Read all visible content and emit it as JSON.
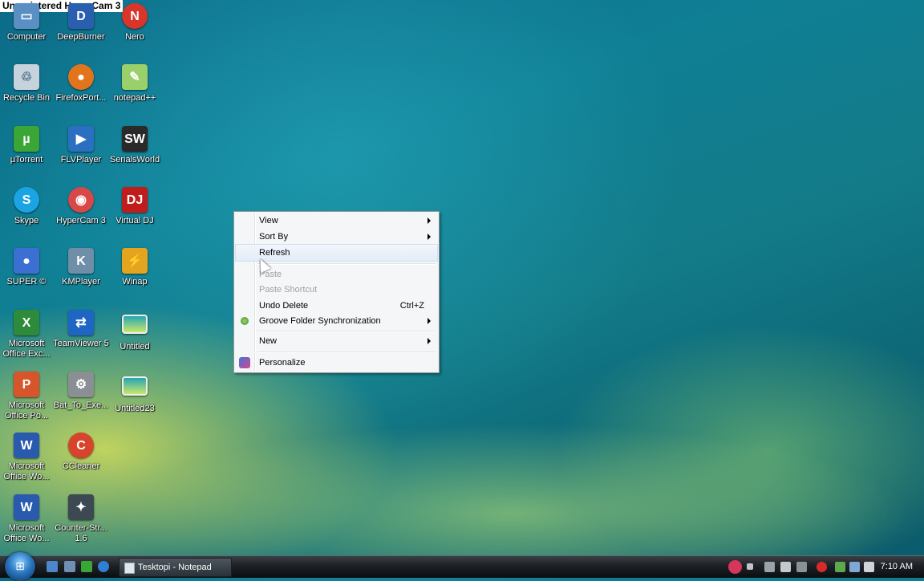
{
  "banner": {
    "text": "Unregistered HyperCam 3"
  },
  "desktop_icons": [
    {
      "label": "Computer",
      "icon": "computer-icon",
      "color": "#5a8fc4"
    },
    {
      "label": "DeepBurner",
      "icon": "deepburner-icon",
      "color": "#2a5fb0"
    },
    {
      "label": "Nero",
      "icon": "nero-icon",
      "color": "#d8352b"
    },
    {
      "label": "Recycle Bin",
      "icon": "recycle-bin-icon",
      "color": "#c6d3dd"
    },
    {
      "label": "FirefoxPort...",
      "icon": "firefox-icon",
      "color": "#e2741b"
    },
    {
      "label": "notepad++",
      "icon": "notepad-plus-plus-icon",
      "color": "#9ad06a"
    },
    {
      "label": "µTorrent",
      "icon": "utorrent-icon",
      "color": "#3aa635"
    },
    {
      "label": "FLVPlayer",
      "icon": "flvplayer-icon",
      "color": "#2b6fc1"
    },
    {
      "label": "SerialsWorld",
      "icon": "serialsworld-icon",
      "color": "#2a2a2a"
    },
    {
      "label": "Skype",
      "icon": "skype-icon",
      "color": "#1ba4e3"
    },
    {
      "label": "HyperCam 3",
      "icon": "hypercam-icon",
      "color": "#d94848"
    },
    {
      "label": "Virtual DJ",
      "icon": "virtual-dj-icon",
      "color": "#c11c1c"
    },
    {
      "label": "SUPER ©",
      "icon": "super-icon",
      "color": "#3b6fd1"
    },
    {
      "label": "KMPlayer",
      "icon": "kmplayer-icon",
      "color": "#6f8ea8"
    },
    {
      "label": "Winap",
      "icon": "winamp-icon",
      "color": "#e3a520"
    },
    {
      "label": "Microsoft Office Exc...",
      "icon": "excel-icon",
      "color": "#2e8b3c"
    },
    {
      "label": "TeamViewer 5",
      "icon": "teamviewer-icon",
      "color": "#1f66c4"
    },
    {
      "label": "Untitled",
      "icon": "image-file-icon",
      "color": "#27a6b4"
    },
    {
      "label": "Microsoft Office Po...",
      "icon": "powerpoint-icon",
      "color": "#d7552b"
    },
    {
      "label": "Bat_To_Exe...",
      "icon": "bat-to-exe-icon",
      "color": "#8a8f94"
    },
    {
      "label": "Untitled23",
      "icon": "image-file-icon",
      "color": "#27a6b4"
    },
    {
      "label": "Microsoft Office Wo...",
      "icon": "word-icon",
      "color": "#2a5aae"
    },
    {
      "label": "CCleaner",
      "icon": "ccleaner-icon",
      "color": "#d8442b"
    },
    {
      "label": "Microsoft Office Wo...",
      "icon": "word-icon",
      "color": "#2a5aae"
    },
    {
      "label": "Counter-Str... 1.6",
      "icon": "counter-strike-icon",
      "color": "#3c4852"
    }
  ],
  "context_menu": {
    "items": [
      {
        "label": "View",
        "submenu": true
      },
      {
        "label": "Sort By",
        "submenu": true
      },
      {
        "label": "Refresh"
      },
      {
        "label": "Paste",
        "disabled": true
      },
      {
        "label": "Paste Shortcut",
        "disabled": true
      },
      {
        "label": "Undo Delete",
        "shortcut": "Ctrl+Z"
      },
      {
        "label": "Groove Folder Synchronization",
        "submenu": true,
        "icon": "groove-icon"
      },
      {
        "label": "New",
        "submenu": true
      },
      {
        "label": "Personalize",
        "icon": "personalize-icon"
      }
    ]
  },
  "taskbar": {
    "start_icon": "windows-start-orb-icon",
    "quick_launch": [
      "show-desktop-icon",
      "switch-windows-icon",
      "utorrent-icon",
      "internet-explorer-icon"
    ],
    "tasks": [
      {
        "label": "Tesktopi - Notepad",
        "icon": "notepad-icon"
      }
    ],
    "tray_icons": [
      "hypercam-record-icon",
      "stop-icon",
      "network-icon",
      "tools-icon",
      "expand-icon",
      "security-alert-icon",
      "network-status-icon",
      "display-icon",
      "volume-icon"
    ],
    "clock": "7:10 AM"
  }
}
